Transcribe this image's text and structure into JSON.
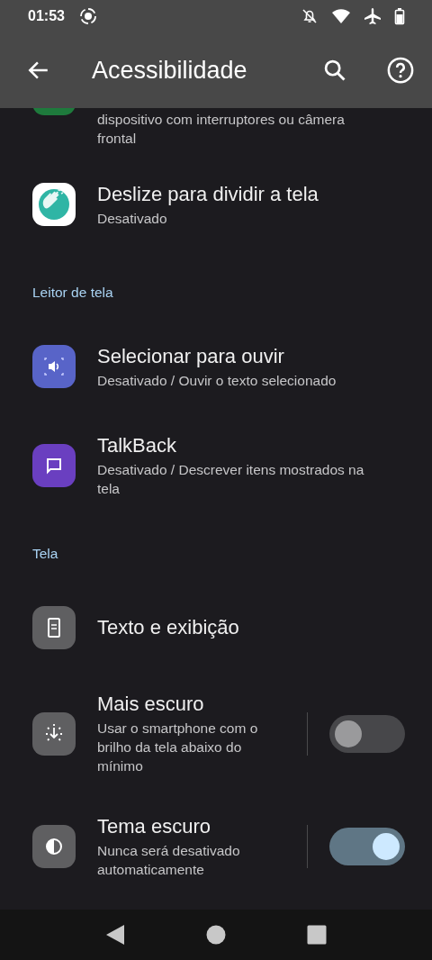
{
  "status_bar": {
    "time": "01:53"
  },
  "app_bar": {
    "title": "Acessibilidade"
  },
  "sections": [
    {
      "items": [
        {
          "kind": "partial",
          "summary": "dispositivo com interruptores ou câmera frontal",
          "color": "#1e7a3c"
        },
        {
          "kind": "plain",
          "title": "Deslize para dividir a tela",
          "summary": "Desativado",
          "color": "#ffffff"
        }
      ]
    },
    {
      "header": "Leitor de tela",
      "items": [
        {
          "kind": "plain",
          "title": "Selecionar para ouvir",
          "summary": "Desativado / Ouvir o texto selecionado",
          "color": "#5864c8"
        },
        {
          "kind": "plain",
          "title": "TalkBack",
          "summary": "Desativado / Descrever itens mostrados na tela",
          "color": "#6a3fc0"
        }
      ]
    },
    {
      "header": "Tela",
      "items": [
        {
          "kind": "plain",
          "title": "Texto e exibição",
          "color": "#5f5f61"
        },
        {
          "kind": "switch",
          "title": "Mais escuro",
          "summary": "Usar o smartphone com o brilho da tela abaixo do mínimo",
          "color": "#5f5f61",
          "on": false
        },
        {
          "kind": "switch",
          "title": "Tema escuro",
          "summary": "Nunca será desativado automaticamente",
          "color": "#5f5f61",
          "on": true
        }
      ]
    }
  ]
}
